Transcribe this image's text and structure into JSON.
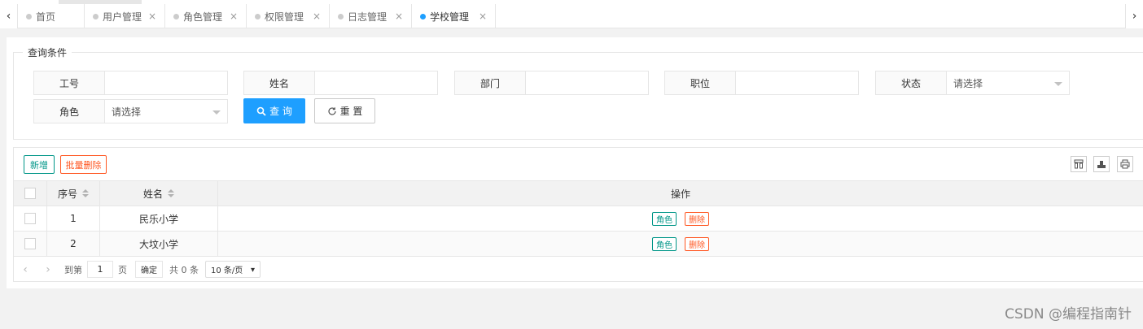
{
  "tabs": [
    {
      "label": "首页",
      "closable": false,
      "active": false
    },
    {
      "label": "用户管理",
      "closable": true,
      "active": false
    },
    {
      "label": "角色管理",
      "closable": true,
      "active": false
    },
    {
      "label": "权限管理",
      "closable": true,
      "active": false
    },
    {
      "label": "日志管理",
      "closable": true,
      "active": false
    },
    {
      "label": "学校管理",
      "closable": true,
      "active": true
    }
  ],
  "tab_close_glyph": "×",
  "nav": {
    "prev": "‹",
    "next": "›"
  },
  "query": {
    "legend": "查询条件",
    "fields": {
      "emp_no": {
        "label": "工号",
        "value": ""
      },
      "name": {
        "label": "姓名",
        "value": ""
      },
      "dept": {
        "label": "部门",
        "value": ""
      },
      "position": {
        "label": "职位",
        "value": ""
      },
      "status": {
        "label": "状态",
        "value": "请选择"
      },
      "role": {
        "label": "角色",
        "value": "请选择"
      }
    },
    "search_label": "查 询",
    "reset_label": "重 置"
  },
  "toolbar": {
    "add_label": "新增",
    "batch_delete_label": "批量删除"
  },
  "table": {
    "headers": {
      "no": "序号",
      "name": "姓名",
      "op": "操作"
    },
    "rows": [
      {
        "no": "1",
        "name": "民乐小学",
        "role_btn": "角色",
        "del_btn": "删除"
      },
      {
        "no": "2",
        "name": "大坟小学",
        "role_btn": "角色",
        "del_btn": "删除"
      }
    ]
  },
  "pager": {
    "goto_label": "到第",
    "page_value": "1",
    "page_unit": "页",
    "confirm_label": "确定",
    "total_label": "共 0 条",
    "page_size": "10 条/页"
  },
  "watermark": "CSDN @编程指南针",
  "colors": {
    "primary": "#1e9fff",
    "teal": "#009688",
    "danger": "#ff5722"
  }
}
